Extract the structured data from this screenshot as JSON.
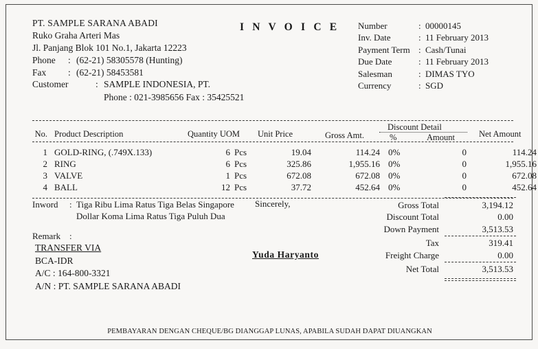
{
  "document": {
    "title": "I N V O I C E",
    "footer_note": "PEMBAYARAN DENGAN CHEQUE/BG DIANGGAP LUNAS, APABILA SUDAH DAPAT DIUANGKAN"
  },
  "company": {
    "name": "PT. SAMPLE SARANA ABADI",
    "address_line1": "Ruko Graha Arteri Mas",
    "address_line2": "Jl. Panjang Blok 101 No.1, Jakarta 12223",
    "phone_label": "Phone",
    "phone_value": "(62-21) 58305578 (Hunting)",
    "fax_label": "Fax",
    "fax_value": "(62-21) 58453581",
    "colon": ":"
  },
  "customer": {
    "label": "Customer",
    "colon": ":",
    "name": "SAMPLE  INDONESIA, PT.",
    "contact": "Phone : 021-3985656   Fax : 35425521"
  },
  "meta": {
    "colon": ":",
    "rows": [
      {
        "label": "Number",
        "value": "00000145"
      },
      {
        "label": "Inv. Date",
        "value": "11 February 2013"
      },
      {
        "label": "Payment Term",
        "value": "Cash/Tunai"
      },
      {
        "label": "Due Date",
        "value": "11 February 2013"
      },
      {
        "label": "Salesman",
        "value": "DIMAS TYO"
      },
      {
        "label": "Currency",
        "value": "SGD"
      }
    ]
  },
  "table": {
    "headers": {
      "no": "No.",
      "description": "Product Description",
      "quantity_uom": "Quantity UOM",
      "unit_price": "Unit Price",
      "gross_amount": "Gross Amt.",
      "discount_detail": "Discount Detail",
      "discount_percent": "%",
      "discount_amount": "Amount",
      "net_amount": "Net Amount"
    },
    "rows": [
      {
        "no": "1",
        "description": "GOLD-RING, (.749X.133)",
        "quantity": "6",
        "uom": "Pcs",
        "unit_price": "19.04",
        "gross": "114.24",
        "disc_pct": "0%",
        "disc_amt": "0",
        "net": "114.24"
      },
      {
        "no": "2",
        "description": "RING",
        "quantity": "6",
        "uom": "Pcs",
        "unit_price": "325.86",
        "gross": "1,955.16",
        "disc_pct": "0%",
        "disc_amt": "0",
        "net": "1,955.16"
      },
      {
        "no": "3",
        "description": "VALVE",
        "quantity": "1",
        "uom": "Pcs",
        "unit_price": "672.08",
        "gross": "672.08",
        "disc_pct": "0%",
        "disc_amt": "0",
        "net": "672.08"
      },
      {
        "no": "4",
        "description": "BALL",
        "quantity": "12",
        "uom": "Pcs",
        "unit_price": "37.72",
        "gross": "452.64",
        "disc_pct": "0%",
        "disc_amt": "0",
        "net": "452.64"
      }
    ]
  },
  "inword": {
    "label": "Inword",
    "colon": ":",
    "line1": "Tiga Ribu Lima Ratus Tiga Belas Singapore",
    "line2": "Dollar Koma Lima Ratus Tiga Puluh Dua",
    "remark_label": "Remark",
    "remark_colon": ":",
    "remark_value": ""
  },
  "signature": {
    "sincerely": "Sincerely,",
    "name": "Yuda  Haryanto"
  },
  "bank": {
    "title": "TRANSFER VIA",
    "bank_name": "BCA-IDR",
    "account_number": "A/C : 164-800-3321",
    "account_name": "A/N : PT. SAMPLE SARANA ABADI"
  },
  "totals": {
    "rows": [
      {
        "label": "Gross Total",
        "value": "3,194.12"
      },
      {
        "label": "Discount Total",
        "value": "0.00"
      },
      {
        "label": "Down Payment",
        "value": "3,513.53"
      },
      {
        "label": "Tax",
        "value": "319.41"
      },
      {
        "label": "Freight Charge",
        "value": "0.00"
      },
      {
        "label": "Net Total",
        "value": "3,513.53"
      }
    ]
  },
  "colors": {
    "paper": "#f8f7f5",
    "ink": "#1a1a1a",
    "border": "#4a4a48"
  }
}
